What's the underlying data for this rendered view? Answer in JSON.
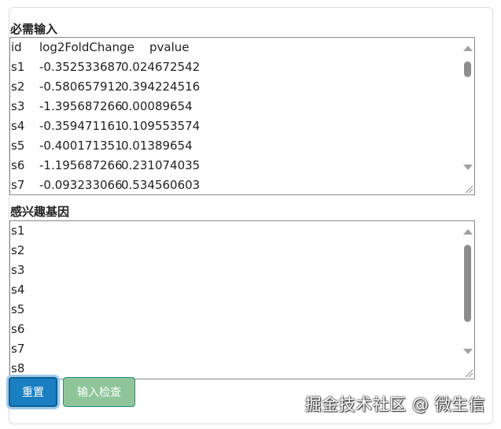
{
  "required_input": {
    "label": "必需输入",
    "rows": [
      [
        "id",
        "log2FoldChange",
        "pvalue"
      ],
      [
        "s1",
        "-0.352533687",
        "0.024672542"
      ],
      [
        "s2",
        "-0.580657912",
        "0.394224516"
      ],
      [
        "s3",
        "-1.395687266",
        "0.00089654"
      ],
      [
        "s4",
        "-0.359471161",
        "0.109553574"
      ],
      [
        "s5",
        "-0.400171351",
        "0.01389654"
      ],
      [
        "s6",
        "-1.195687266",
        "0.231074035"
      ],
      [
        "s7",
        "-0.093233066",
        "0.534560603"
      ]
    ]
  },
  "genes_of_interest": {
    "label": "感兴趣基因",
    "lines": [
      "s1",
      "s2",
      "s3",
      "s4",
      "s5",
      "s6",
      "s7",
      "s8"
    ]
  },
  "buttons": {
    "reset": "重置",
    "input_check": "输入检查"
  },
  "watermark": "掘金技术社区 @ 微生信",
  "colors": {
    "reset_button": "#1a7fc1",
    "check_button": "#8ec69a"
  }
}
